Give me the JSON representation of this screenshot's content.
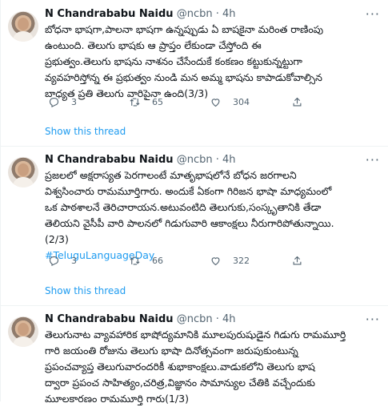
{
  "tweets": [
    {
      "name": "N Chandrababu Naidu",
      "handle": "@ncbn",
      "dot": "·",
      "time": "4h",
      "more": "···",
      "lines": [
        "బోధనా భాషగా,పాలనా భాషగా ఉన్నప్పుడు ఏ బాషకైనా మరింత రాణింపు",
        "ఉంటుంది. తెలుగు భాషకు ఆ ప్రాప్తం లేకుండా చేస్తోంది ఈ",
        "ప్రభుత్వం.తెలుగు భాషను నాశనం చేసేందుకే కంకణం కట్టుకున్నట్టుగా",
        "వ్యవహరిస్తోన్న ఈ ప్రభుత్వం నుండి మన అమ్మ భాషను కాపాడుకోవాల్సిన",
        "బాధ్యత ప్రతి తెలుగు వారిపైనా ఉంది(3/3)"
      ],
      "replies": "3",
      "retweets": "65",
      "likes": "304",
      "show_thread": "Show this thread"
    },
    {
      "name": "N Chandrababu Naidu",
      "handle": "@ncbn",
      "dot": "·",
      "time": "4h",
      "more": "···",
      "lines": [
        "ప్రజలలో అక్షరాస్యత పెరగాలంటే మాతృభాషలోనే బోధన జరగాలని",
        "విశ్వసించారు రామమూర్తిగారు. అందుకే ఏకంగా గిరిజన భాషా మాధ్యమంలో",
        "ఒక పాఠశాలనే తెరిచారాయన.అటువంటిది తెలుగుకు,సంస్కృతానికి తేడా",
        "తెలియని వైసీపీ వారి పాలనలో గిడుగువారి ఆకాంక్షలు నీరుగారిపోతున్నాయి.",
        "(2/3)"
      ],
      "hashtag": "#TeluguLanguageDay",
      "replies": "3",
      "retweets": "66",
      "likes": "322",
      "show_thread": "Show this thread"
    },
    {
      "name": "N Chandrababu Naidu",
      "handle": "@ncbn",
      "dot": "·",
      "time": "4h",
      "more": "···",
      "lines": [
        "తెలుగునాట వ్యావహారిక భాషోద్యమానికి మూలపురుషుడైన గిడుగు రామమూర్తి",
        "గారి జయంతి రోజును తెలుగు భాషా దినోత్సవంగా జరుపుకుంటున్న",
        "ప్రపంచవ్యాప్త తెలుగువారందరికీ శుభాకాంక్షలు.వాడుకలోని తెలుగు భాష",
        "ద్వారా ప్రపంచ సాహిత్యం,చరిత్ర,విజ్ఞానం సామాన్యుల చేతికి వచ్చేందుకు",
        "మూలకారణం రామమూర్తి గారు(1/3)"
      ]
    }
  ],
  "colors": {
    "accent": "#1d9bf0",
    "secondary": "#536471",
    "text": "#0f1419"
  },
  "icons": [
    "reply-icon",
    "retweet-icon",
    "like-icon",
    "share-icon",
    "more-icon"
  ]
}
